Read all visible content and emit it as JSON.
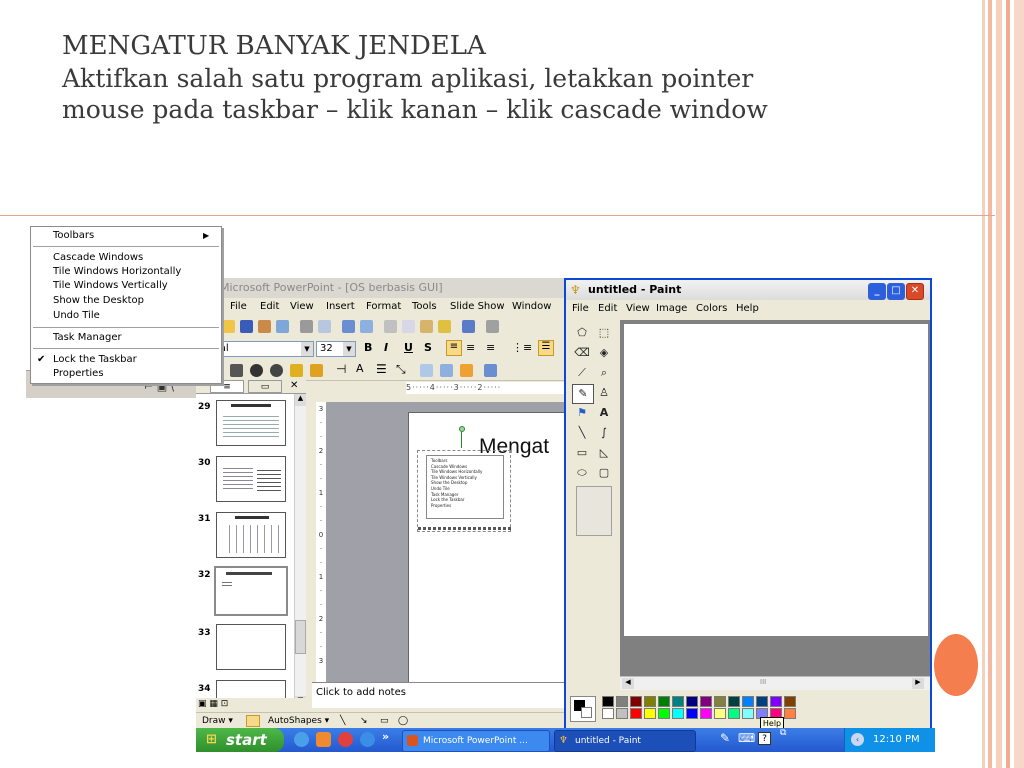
{
  "slide": {
    "title": "MENGATUR BANYAK JENDELA",
    "body": "Aktifkan salah satu program aplikasi, letakkan pointer mouse pada taskbar – klik kanan – klik cascade window"
  },
  "context_menu": {
    "toolbars": "Toolbars",
    "cascade": "Cascade Windows",
    "tile_h": "Tile Windows Horizontally",
    "tile_v": "Tile Windows Vertically",
    "show_desktop": "Show the Desktop",
    "undo_tile": "Undo Tile",
    "task_manager": "Task Manager",
    "lock_taskbar": "Lock the Taskbar",
    "properties": "Properties"
  },
  "powerpoint": {
    "title": "Microsoft PowerPoint - [OS berbasis GUI]",
    "menu": [
      "File",
      "Edit",
      "View",
      "Insert",
      "Format",
      "Tools",
      "Slide Show",
      "Window"
    ],
    "font_name": "Arial",
    "font_size": "32",
    "format_buttons": [
      "B",
      "I",
      "U",
      "S"
    ],
    "slide_numbers": [
      "29",
      "30",
      "31",
      "32",
      "33",
      "34"
    ],
    "slide_heading": "Mengat",
    "notes_placeholder": "Click to add notes",
    "draw_label": "Draw ▾",
    "autoshapes_label": "AutoShapes ▾",
    "embedded_menu": [
      "Toolbars",
      "Cascade Windows",
      "Tile Windows Horizontally",
      "Tile Windows Vertically",
      "Show the Desktop",
      "Undo Tile",
      "Task Manager",
      "Lock the Taskbar",
      "Properties"
    ]
  },
  "paint": {
    "title": "untitled - Paint",
    "menu": [
      "File",
      "Edit",
      "View",
      "Image",
      "Colors",
      "Help"
    ],
    "tooltip": "Help",
    "palette": [
      "#000000",
      "#808080",
      "#800000",
      "#808000",
      "#008000",
      "#008080",
      "#000080",
      "#800080",
      "#808040",
      "#004040",
      "#0080ff",
      "#004080",
      "#8000ff",
      "#804000",
      "#ffffff",
      "#c0c0c0",
      "#ff0000",
      "#ffff00",
      "#00ff00",
      "#00ffff",
      "#0000ff",
      "#ff00ff",
      "#ffff80",
      "#00ff80",
      "#80ffff",
      "#8080ff",
      "#ff0080",
      "#ff8040"
    ]
  },
  "taskbar": {
    "start": "start",
    "tasks": [
      "Microsoft PowerPoint ...",
      "untitled - Paint"
    ],
    "clock": "12:10 PM"
  },
  "colors": {
    "title_text": "#3a3a3a",
    "xp_blue": "#2458d0",
    "start_green": "#3fa23b",
    "accent_orange": "#f57e4e",
    "stripe": "#f4c7b3"
  }
}
